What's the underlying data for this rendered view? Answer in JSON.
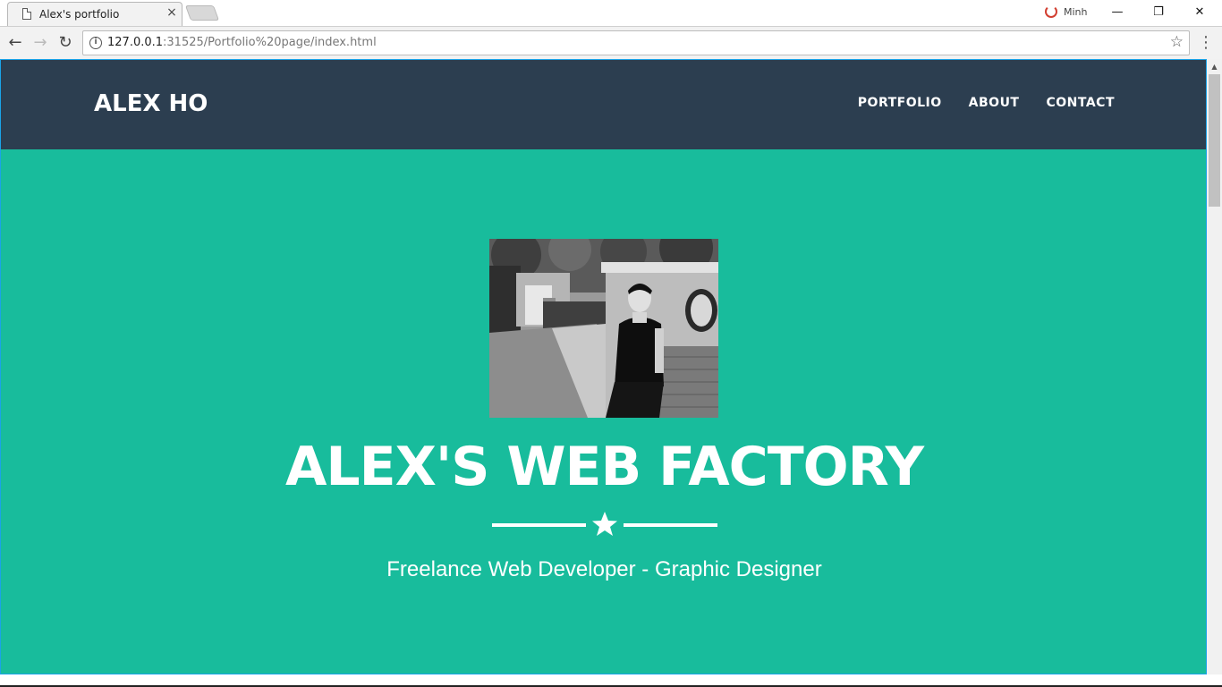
{
  "browser": {
    "tab": {
      "title": "Alex's portfolio",
      "close": "×"
    },
    "profile": {
      "name": "Minh"
    },
    "window": {
      "minimize": "—",
      "restore": "❐",
      "close": "✕"
    },
    "toolbar": {
      "back": "←",
      "forward": "→",
      "reload": "↻",
      "info": "i",
      "url_host": "127.0.0.1",
      "url_rest": ":31525/Portfolio%20page/index.html",
      "bookmark": "☆",
      "menu": "⋮"
    }
  },
  "site": {
    "brand": "ALEX HO",
    "nav": [
      {
        "label": "PORTFOLIO"
      },
      {
        "label": "ABOUT"
      },
      {
        "label": "CONTACT"
      }
    ],
    "hero": {
      "title": "ALEX'S WEB FACTORY",
      "subtitle": "Freelance Web Developer - Graphic Designer",
      "photo_alt": "profile photo"
    }
  },
  "colors": {
    "nav_bg": "#2c3e50",
    "hero_bg": "#18bc9c",
    "text": "#ffffff"
  },
  "icons": {
    "tab": "file-icon",
    "star": "star-icon",
    "bookmark": "bookmark-star-icon"
  }
}
